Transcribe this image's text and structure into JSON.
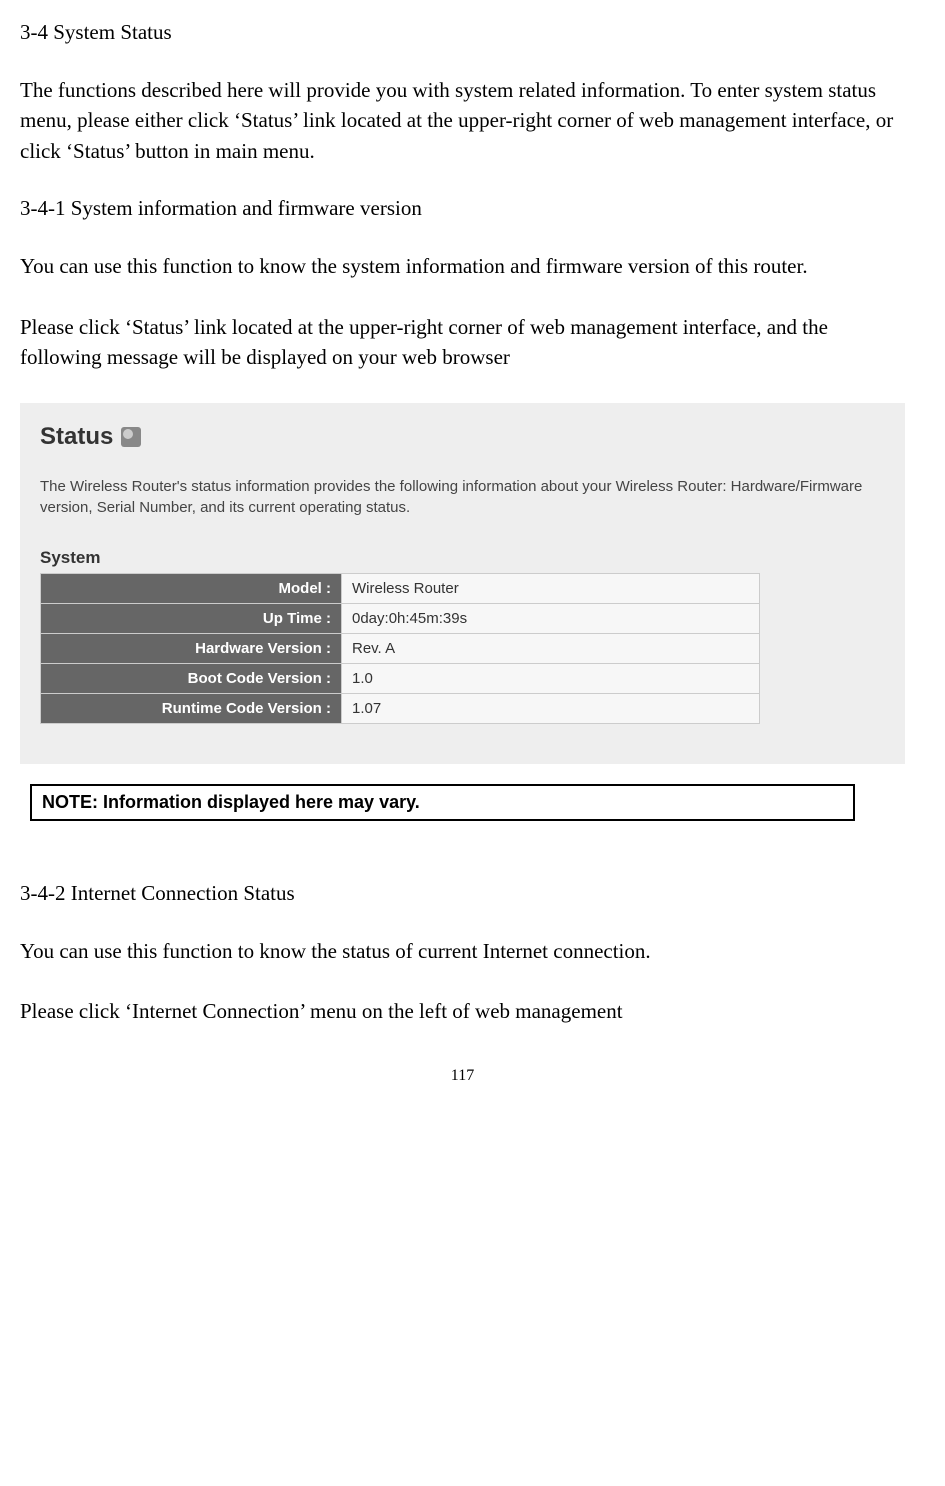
{
  "section1_title": "3-4 System Status",
  "section1_p1": "The functions described here will provide you with system related information. To enter system status menu, please either click ‘Status’ link located at the upper-right corner of web management interface, or click ‘Status’ button in main menu.",
  "section1_1_title": "3-4-1 System information and firmware version",
  "section1_1_p1": "You can use this function to know the system information and firmware version of this router.",
  "section1_1_p2": "Please click ‘Status’ link located at the upper-right corner of web management interface, and the following message will be displayed on your web browser",
  "panel": {
    "title": "Status",
    "description": "The Wireless Router's status information provides the following information about your Wireless Router: Hardware/Firmware version, Serial Number, and its current operating status.",
    "system_label": "System",
    "rows": [
      {
        "label": "Model :",
        "value": "Wireless Router"
      },
      {
        "label": "Up Time :",
        "value": "0day:0h:45m:39s"
      },
      {
        "label": "Hardware Version :",
        "value": "Rev. A"
      },
      {
        "label": "Boot Code Version :",
        "value": "1.0"
      },
      {
        "label": "Runtime Code Version :",
        "value": "1.07"
      }
    ]
  },
  "note_text": "NOTE: Information displayed here may vary.",
  "section1_2_title": "3-4-2 Internet Connection Status",
  "section1_2_p1": "You can use this function to know the status of current Internet connection.",
  "section1_2_p2": "Please click ‘Internet Connection’ menu on the left of web management",
  "page_number": "117"
}
